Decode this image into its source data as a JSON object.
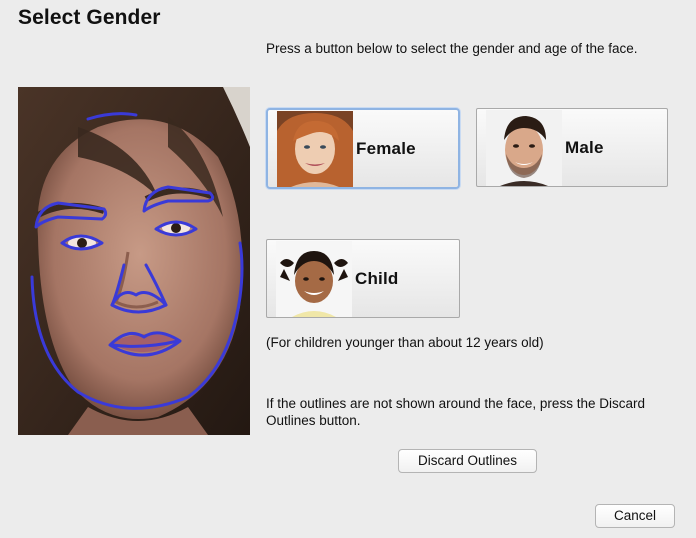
{
  "dialog": {
    "title": "Select Gender",
    "instruction": "Press a button below to select the gender and age of the face.",
    "child_note": "(For children younger than about 12 years old)",
    "outline_help": "If the outlines are not shown around the face, press the Discard Outlines button.",
    "discard_label": "Discard Outlines",
    "cancel_label": "Cancel"
  },
  "choices": {
    "female_label": "Female",
    "male_label": "Male",
    "child_label": "Child",
    "selected": "female"
  },
  "colors": {
    "background": "#ececec",
    "outline": "#3a3ad8",
    "selection_border": "#8fb4e3"
  }
}
